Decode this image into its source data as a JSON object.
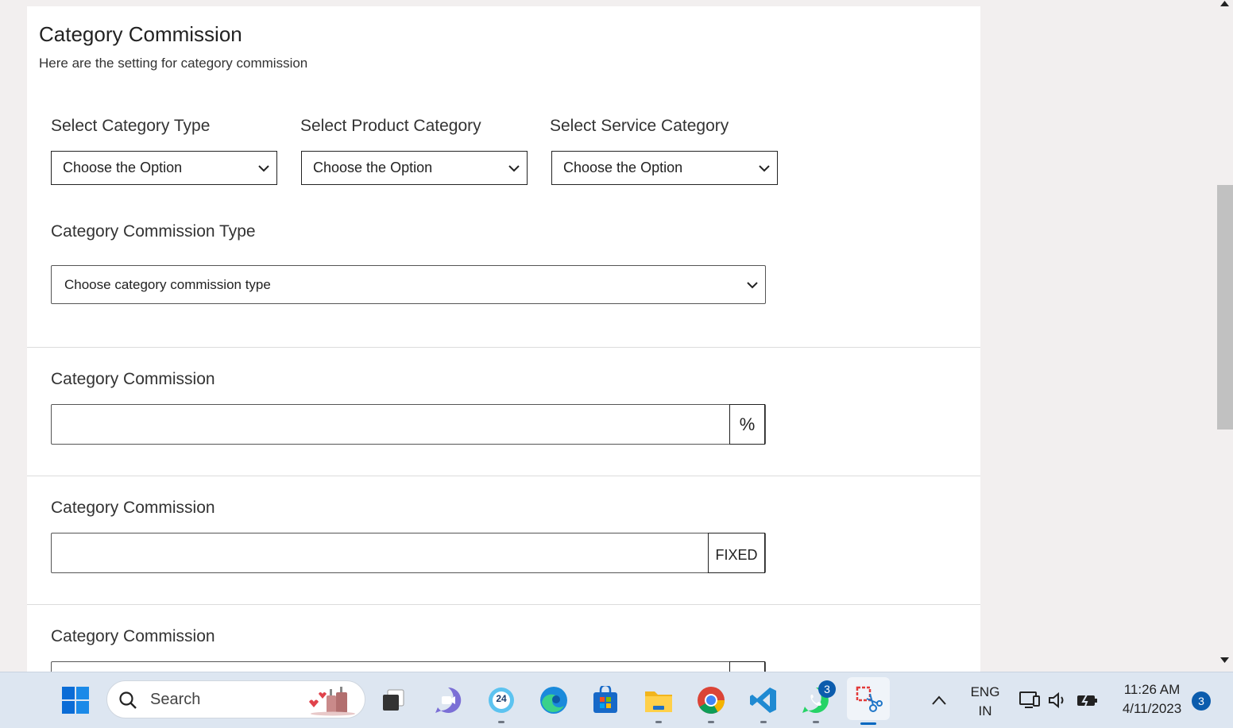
{
  "page": {
    "title": "Category Commission",
    "subtitle": "Here are the setting for category commission"
  },
  "filters": {
    "category_type": {
      "label": "Select Category Type",
      "value": "Choose the Option"
    },
    "product_category": {
      "label": "Select Product Category",
      "value": "Choose the Option"
    },
    "service_category": {
      "label": "Select Service Category",
      "value": "Choose the Option"
    }
  },
  "commission_type": {
    "label": "Category Commission Type",
    "value": "Choose category commission type"
  },
  "commission_sections": [
    {
      "label": "Category Commission",
      "value": "",
      "addon": "%"
    },
    {
      "label": "Category Commission",
      "value": "",
      "addon": "FIXED"
    },
    {
      "label": "Category Commission",
      "value": "",
      "addon": ""
    }
  ],
  "taskbar": {
    "search_placeholder": "Search",
    "calendar_badge": "24",
    "whatsapp_badge": "3",
    "language_line1": "ENG",
    "language_line2": "IN",
    "time": "11:26 AM",
    "date": "4/11/2023",
    "notification_count": "3",
    "apps": [
      "windows-start",
      "search",
      "task-view",
      "teams-chat",
      "calendar",
      "edge",
      "microsoft-store",
      "file-explorer",
      "chrome",
      "vscode",
      "whatsapp",
      "snipping-tool"
    ]
  },
  "colors": {
    "page_bg": "#f2efef",
    "card_bg": "#ffffff",
    "taskbar_bg": "#dde6f1",
    "accent": "#0067c0"
  }
}
